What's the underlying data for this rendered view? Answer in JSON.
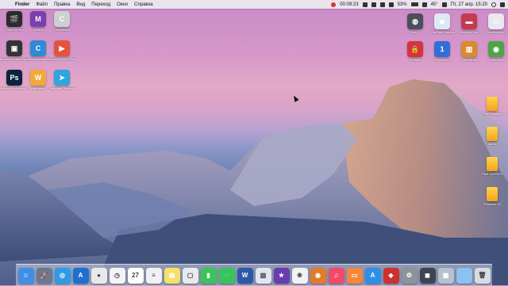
{
  "menubar": {
    "apple": "",
    "items": [
      "Finder",
      "Файл",
      "Правка",
      "Вид",
      "Переход",
      "Окно",
      "Справка"
    ],
    "status": {
      "timer": "00:09:23",
      "battery": "53%",
      "temperature": "45°",
      "datetime": "Пт, 27 апр. 15:20"
    }
  },
  "desktop_left": [
    {
      "label": "Final Cut Pro",
      "color": "#2b2b2b",
      "glyph": "🎬"
    },
    {
      "label": "Motion",
      "color": "#7a3fb0",
      "glyph": "M"
    },
    {
      "label": "Compressor",
      "color": "#cfcfcf",
      "glyph": "C"
    },
    {
      "label": "Movavi Screen Capture",
      "color": "#333333",
      "glyph": "▣"
    },
    {
      "label": "CleanMyMac 3",
      "color": "#2e8bd6",
      "glyph": "C"
    },
    {
      "label": "Movavi Screen Recorder",
      "color": "#e5533c",
      "glyph": "▶"
    },
    {
      "label": "Adobe Photoshop CC 2018",
      "color": "#0b2340",
      "glyph": "Ps"
    },
    {
      "label": "Watermark",
      "color": "#f2a93b",
      "glyph": "W"
    },
    {
      "label": "Telegram Desktop",
      "color": "#2ea6de",
      "glyph": "➤"
    }
  ],
  "desktop_right": [
    {
      "label": "Hider 2",
      "color": "#4a4f5a",
      "glyph": "◍"
    },
    {
      "label": "MacFlow Sonnar",
      "color": "#dde8f5",
      "glyph": "◆"
    },
    {
      "label": "CleanMyDrive",
      "color": "#c63a4f",
      "glyph": "▬"
    },
    {
      "label": "CleanMyMac 3",
      "color": "#e8e8ee",
      "glyph": "▭"
    },
    {
      "label": "Privatus",
      "color": "#d7333a",
      "glyph": "🔒"
    },
    {
      "label": "1Password",
      "color": "#2f6fd8",
      "glyph": "1"
    },
    {
      "label": "OpenStreet",
      "color": "#d98a2c",
      "glyph": "▥"
    },
    {
      "label": "TorBrowser",
      "color": "#4fa34a",
      "glyph": "◉"
    }
  ],
  "drives": [
    "Time Machine",
    "LaCie",
    "Final Cut Pro X",
    "Windows 10"
  ],
  "dock": [
    {
      "name": "finder",
      "color": "#3f8fe6",
      "glyph": "☺"
    },
    {
      "name": "launchpad",
      "color": "#6c7890",
      "glyph": "🚀"
    },
    {
      "name": "safari",
      "color": "#2d9be8",
      "glyph": "◎"
    },
    {
      "name": "app-store-blue",
      "color": "#1f6fd0",
      "glyph": "A"
    },
    {
      "name": "chrome",
      "color": "#e9e9e9",
      "glyph": "●"
    },
    {
      "name": "clock",
      "color": "#f4f4f4",
      "glyph": "◷"
    },
    {
      "name": "calendar",
      "color": "#ffffff",
      "glyph": "27"
    },
    {
      "name": "notes-list",
      "color": "#f1f1f1",
      "glyph": "≡"
    },
    {
      "name": "notes",
      "color": "#f6df6a",
      "glyph": "▤"
    },
    {
      "name": "messages",
      "color": "#e9eaee",
      "glyph": "▢"
    },
    {
      "name": "facetime",
      "color": "#3cc35a",
      "glyph": "▮"
    },
    {
      "name": "messages-green",
      "color": "#37c45c",
      "glyph": "◌"
    },
    {
      "name": "word",
      "color": "#2c5aa5",
      "glyph": "W"
    },
    {
      "name": "preview",
      "color": "#dfe6ee",
      "glyph": "▧"
    },
    {
      "name": "imovie",
      "color": "#6b3bb0",
      "glyph": "★"
    },
    {
      "name": "photos",
      "color": "#f2f2f2",
      "glyph": "❀"
    },
    {
      "name": "itunes-alt",
      "color": "#e47b2a",
      "glyph": "◉"
    },
    {
      "name": "music",
      "color": "#f24a6a",
      "glyph": "♫"
    },
    {
      "name": "books",
      "color": "#f5873a",
      "glyph": "▭"
    },
    {
      "name": "app-store",
      "color": "#2e8fe8",
      "glyph": "A"
    },
    {
      "name": "photo-booth",
      "color": "#cc3131",
      "glyph": "◈"
    },
    {
      "name": "system-prefs",
      "color": "#8d939c",
      "glyph": "⚙"
    },
    {
      "name": "quicktime",
      "color": "#404651",
      "glyph": "◼"
    },
    {
      "name": "preview-2",
      "color": "#b7c2cf",
      "glyph": "▩"
    },
    {
      "name": "documents-folder",
      "color": "#8cc2ef",
      "glyph": ""
    },
    {
      "name": "trash",
      "color": "#d8dce2",
      "glyph": "🗑"
    }
  ]
}
